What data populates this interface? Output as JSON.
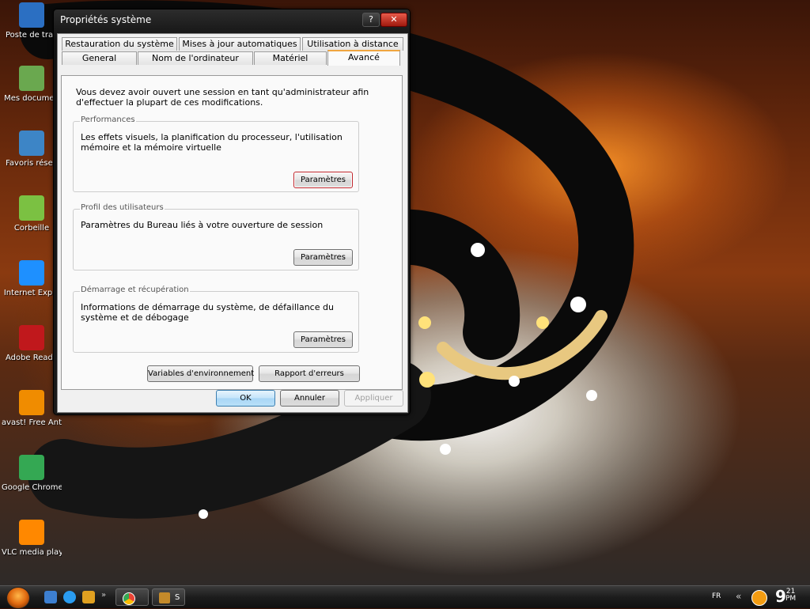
{
  "desktop": {
    "icons": [
      {
        "label": "Poste de trav",
        "icon": "computer-icon",
        "color": "#2b6fc2"
      },
      {
        "label": "Mes documen",
        "icon": "documents-folder-icon",
        "color": "#6aa84f"
      },
      {
        "label": "Favoris résea",
        "icon": "network-icon",
        "color": "#3d85c6"
      },
      {
        "label": "Corbeille",
        "icon": "recycle-bin-icon",
        "color": "#7bc142"
      },
      {
        "label": "Internet Explo",
        "icon": "internet-explorer-icon",
        "color": "#1e90ff"
      },
      {
        "label": "Adobe Reade",
        "icon": "adobe-reader-icon",
        "color": "#c0181c"
      },
      {
        "label": "avast! Free Antivirus",
        "icon": "avast-icon",
        "color": "#f08c00"
      },
      {
        "label": "Google Chrome",
        "icon": "chrome-icon",
        "color": "#34a853"
      },
      {
        "label": "VLC media player",
        "icon": "vlc-icon",
        "color": "#ff8800"
      }
    ]
  },
  "window": {
    "title": "Propriétés système",
    "help_label": "?",
    "close_label": "✕",
    "tabs_row1": [
      "Restauration du système",
      "Mises à jour automatiques",
      "Utilisation à distance"
    ],
    "tabs_row2": [
      "General",
      "Nom de l'ordinateur",
      "Matériel",
      "Avancé"
    ],
    "active_tab": "Avancé",
    "intro": "Vous devez avoir ouvert une session en tant qu'administrateur afin d'effectuer la plupart de ces modifications.",
    "groups": [
      {
        "title": "Performances",
        "description": "Les effets visuels, la planification du processeur, l'utilisation mémoire et la mémoire virtuelle",
        "button": "Paramètres"
      },
      {
        "title": "Profil des utilisateurs",
        "description": "Paramètres du Bureau liés à votre ouverture de session",
        "button": "Paramètres"
      },
      {
        "title": "Démarrage et récupération",
        "description": "Informations de démarrage du système, de défaillance du système et de débogage",
        "button": "Paramètres"
      }
    ],
    "env_button": "Variables d'environnement",
    "error_button": "Rapport d'erreurs",
    "ok": "OK",
    "cancel": "Annuler",
    "apply": "Appliquer"
  },
  "taskbar": {
    "tasks": [
      {
        "label": "",
        "icon": "chrome-icon"
      },
      {
        "label": "S",
        "icon": "winamp-icon"
      }
    ],
    "language": "FR",
    "clock_hour": "9",
    "clock_minute": "21",
    "clock_ampm": "PM"
  }
}
